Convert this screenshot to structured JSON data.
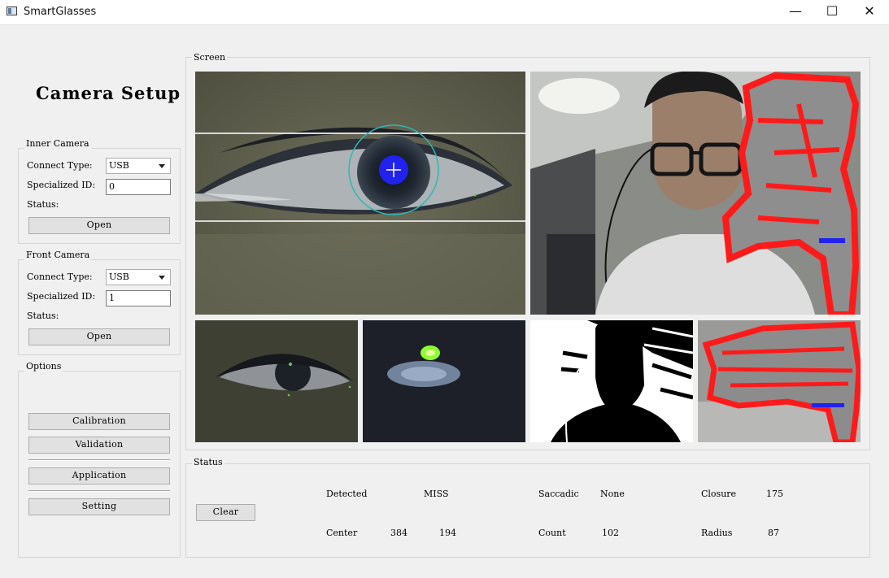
{
  "window": {
    "title": "SmartGlasses",
    "minimize": "—",
    "maximize": "☐",
    "close": "✕"
  },
  "sidebar": {
    "heading": "Camera Setup",
    "inner_camera": {
      "title": "Inner Camera",
      "connect_type_label": "Connect Type:",
      "connect_type_value": "USB",
      "specialized_id_label": "Specialized ID:",
      "specialized_id_value": "0",
      "status_label": "Status:",
      "open_label": "Open"
    },
    "front_camera": {
      "title": "Front Camera",
      "connect_type_label": "Connect Type:",
      "connect_type_value": "USB",
      "specialized_id_label": "Specialized ID:",
      "specialized_id_value": "1",
      "status_label": "Status:",
      "open_label": "Open"
    },
    "options": {
      "title": "Options",
      "calibration_label": "Calibration",
      "validation_label": "Validation",
      "application_label": "Application",
      "setting_label": "Setting"
    }
  },
  "screen": {
    "title": "Screen"
  },
  "status": {
    "title": "Status",
    "clear_label": "Clear",
    "detected_label": "Detected",
    "detected_value": "MISS",
    "center_label": "Center",
    "center_x": "384",
    "center_y": "194",
    "saccadic_label": "Saccadic",
    "saccadic_value": "None",
    "count_label": "Count",
    "count_value": "102",
    "closure_label": "Closure",
    "closure_value": "175",
    "radius_label": "Radius",
    "radius_value": "87"
  },
  "colors": {
    "overlay_red": "#ff1a1a",
    "pupil_blue": "#2222ee",
    "iris_ring": "#2ab8b8",
    "glint_green": "#8cff30"
  }
}
